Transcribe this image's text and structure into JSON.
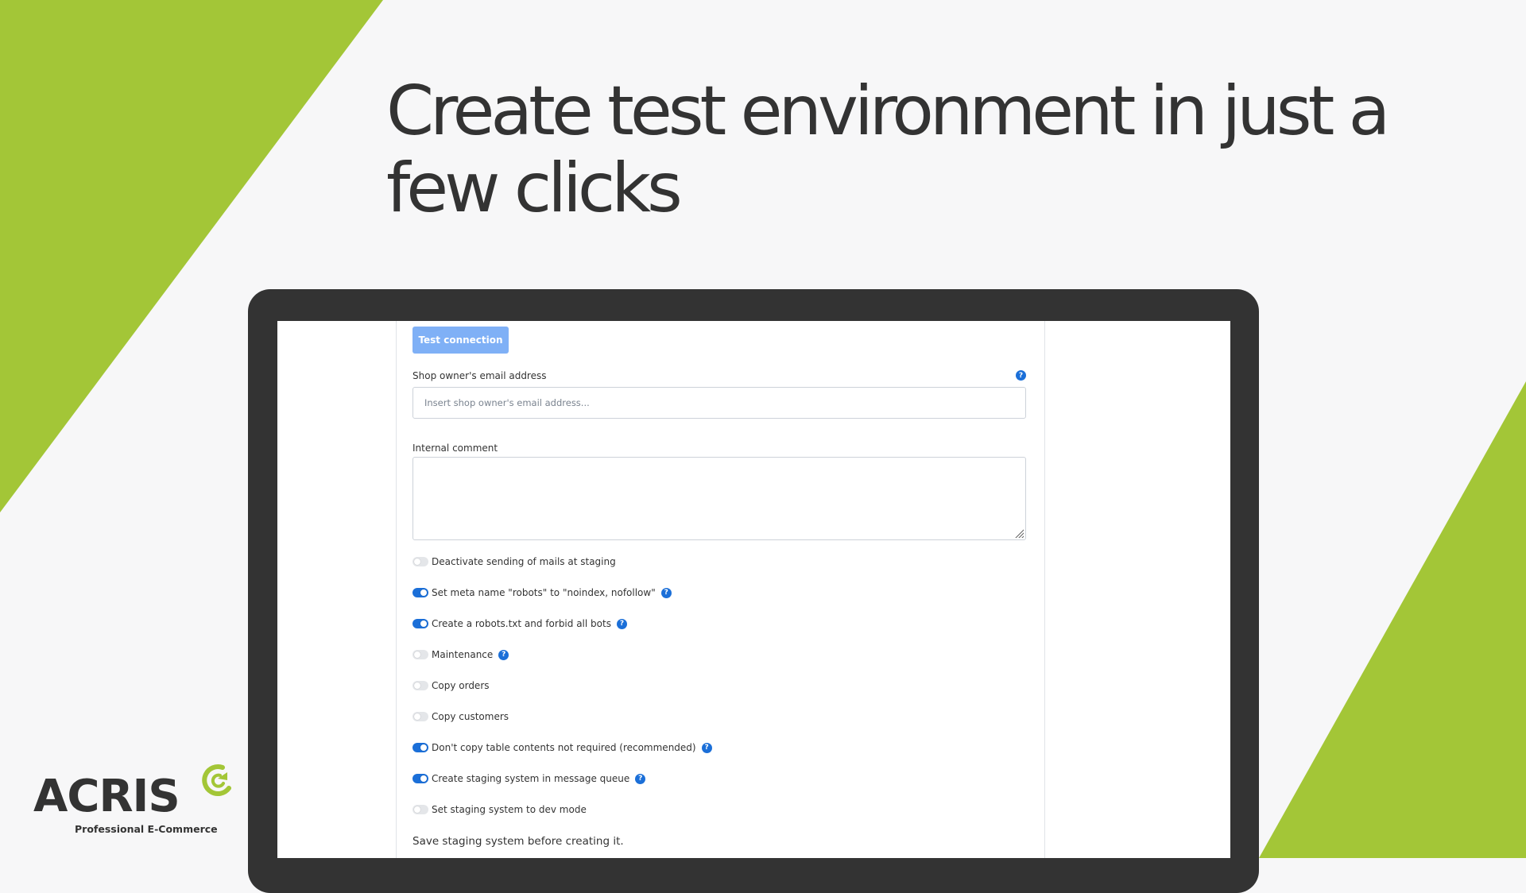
{
  "headline": "Create test environment in just a few clicks",
  "colors": {
    "accent_green": "#a3c637",
    "dark": "#333333",
    "primary_blue": "#1b6fd8",
    "button_blue": "#7fb0f6"
  },
  "form": {
    "test_button": "Test connection",
    "email_label": "Shop owner's email address",
    "email_placeholder": "Insert shop owner's email address...",
    "email_value": "",
    "comment_label": "Internal comment",
    "help_glyph": "?",
    "toggles": [
      {
        "label": "Deactivate sending of mails at staging",
        "on": false,
        "help": false
      },
      {
        "label": "Set meta name \"robots\" to \"noindex, nofollow\"",
        "on": true,
        "help": true
      },
      {
        "label": "Create a robots.txt and forbid all bots",
        "on": true,
        "help": true
      },
      {
        "label": "Maintenance",
        "on": false,
        "help": true
      },
      {
        "label": "Copy orders",
        "on": false,
        "help": false
      },
      {
        "label": "Copy customers",
        "on": false,
        "help": false
      },
      {
        "label": "Don't copy table contents not required (recommended)",
        "on": true,
        "help": true
      },
      {
        "label": "Create staging system in message queue",
        "on": true,
        "help": true
      },
      {
        "label": "Set staging system to dev mode",
        "on": false,
        "help": false
      }
    ],
    "save_note": "Save staging system before creating it."
  },
  "logo": {
    "name": "ACRIS",
    "tagline": "Professional E-Commerce",
    "icon": "acris-c-icon"
  }
}
